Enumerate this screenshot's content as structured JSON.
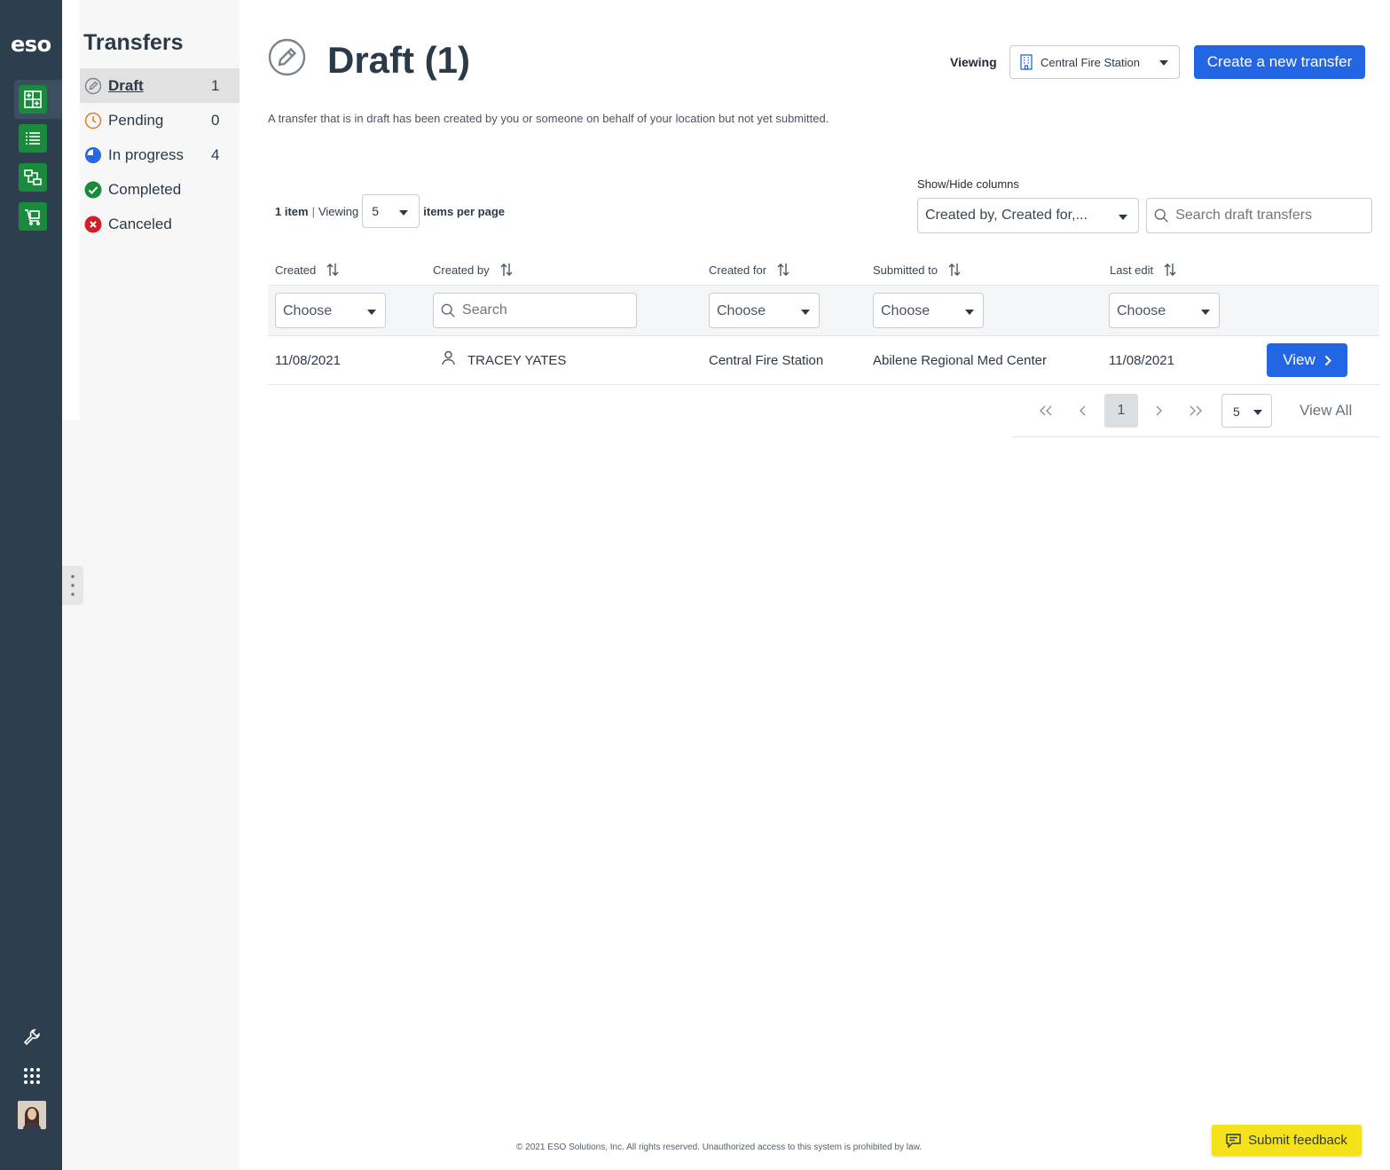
{
  "rail": {
    "logo": "eso",
    "items": [
      "transfers-grid-icon",
      "list-icon",
      "flowchart-icon",
      "cart-icon"
    ],
    "bottom": [
      "wrench-icon",
      "apps-grid-icon",
      "avatar"
    ]
  },
  "sidebar": {
    "title": "Transfers",
    "items": [
      {
        "label": "Draft",
        "count": "1"
      },
      {
        "label": "Pending",
        "count": "0"
      },
      {
        "label": "In progress",
        "count": "4"
      },
      {
        "label": "Completed",
        "count": ""
      },
      {
        "label": "Canceled",
        "count": ""
      }
    ]
  },
  "header": {
    "title": "Draft (1)",
    "viewing_label": "Viewing",
    "station": "Central Fire Station",
    "create_label": "Create a new transfer",
    "description": "A transfer that is in draft has been created by you or someone on behalf of your location but not yet submitted."
  },
  "toolbar": {
    "item_count": "1 item",
    "separator": "|",
    "viewing": "Viewing",
    "per_page": "5",
    "per_page_suffix": "items per page",
    "showhide_label": "Show/Hide columns",
    "columns_value": "Created by, Created for,...",
    "search_placeholder": "Search draft transfers"
  },
  "table": {
    "headers": [
      "Created",
      "Created by",
      "Created for",
      "Submitted to",
      "Last edit"
    ],
    "filters": {
      "choose": "Choose",
      "search_placeholder": "Search"
    },
    "rows": [
      {
        "created": "11/08/2021",
        "created_by": "TRACEY YATES",
        "created_for": "Central Fire Station",
        "submitted_to": "Abilene Regional Med Center",
        "last_edit": "11/08/2021",
        "action": "View"
      }
    ]
  },
  "pager": {
    "first": "«",
    "prev": "‹",
    "current": "1",
    "next": "›",
    "last": "»",
    "size": "5",
    "view_all": "View All"
  },
  "footer": {
    "copyright": "© 2021 ESO Solutions, Inc. All rights reserved. Unauthorized access to this system is prohibited by law.",
    "feedback_label": "Submit feedback"
  },
  "colors": {
    "rail_bg": "#2d3e4e",
    "rail_button": "#1a8a3d",
    "primary": "#2266e3",
    "feedback": "#f6e21b",
    "pending": "#e07b22",
    "progress": "#2266e3",
    "completed": "#1a8a3d",
    "canceled": "#d21f2c"
  }
}
